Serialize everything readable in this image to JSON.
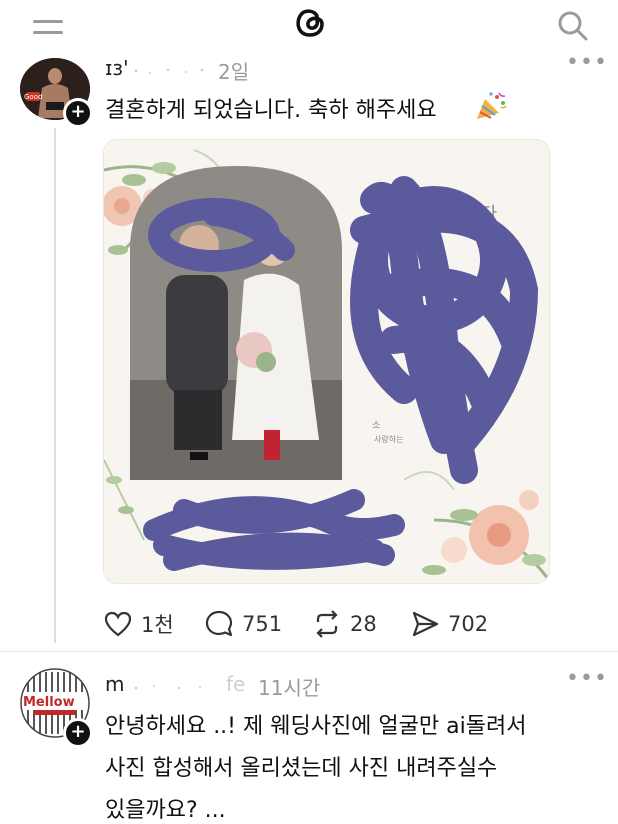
{
  "post": {
    "username": "ɪз'",
    "time": "2일",
    "more": "•••",
    "text": "결혼하게 되었습니다. 축하 해주세요",
    "image_card_text": "니다",
    "image_small_1": "소",
    "image_small_2": "사랑하는",
    "like_count": "1천",
    "reply_count": "751",
    "repost_count": "28",
    "share_count": "702",
    "avatar_text": "Good"
  },
  "comment": {
    "username": "m",
    "username_tail": "fe",
    "time": "11시간",
    "more": "•••",
    "line1": "안녕하세요 ..! 제 웨딩사진에 얼굴만 ai돌려서",
    "line2": "사진 합성해서 올리셨는데 사진 내려주실수",
    "line3": "있을까요? ...",
    "avatar_text": "Mellow"
  },
  "colors": {
    "scribble": "#5b5a9c",
    "divider": "#e6e6e6",
    "muted": "#9a9a9a"
  },
  "icons": [
    "menu-icon",
    "threads-logo-icon",
    "search-icon",
    "plus-icon",
    "more-icon",
    "party-popper-icon",
    "heart-icon",
    "comment-icon",
    "repost-icon",
    "share-icon"
  ]
}
